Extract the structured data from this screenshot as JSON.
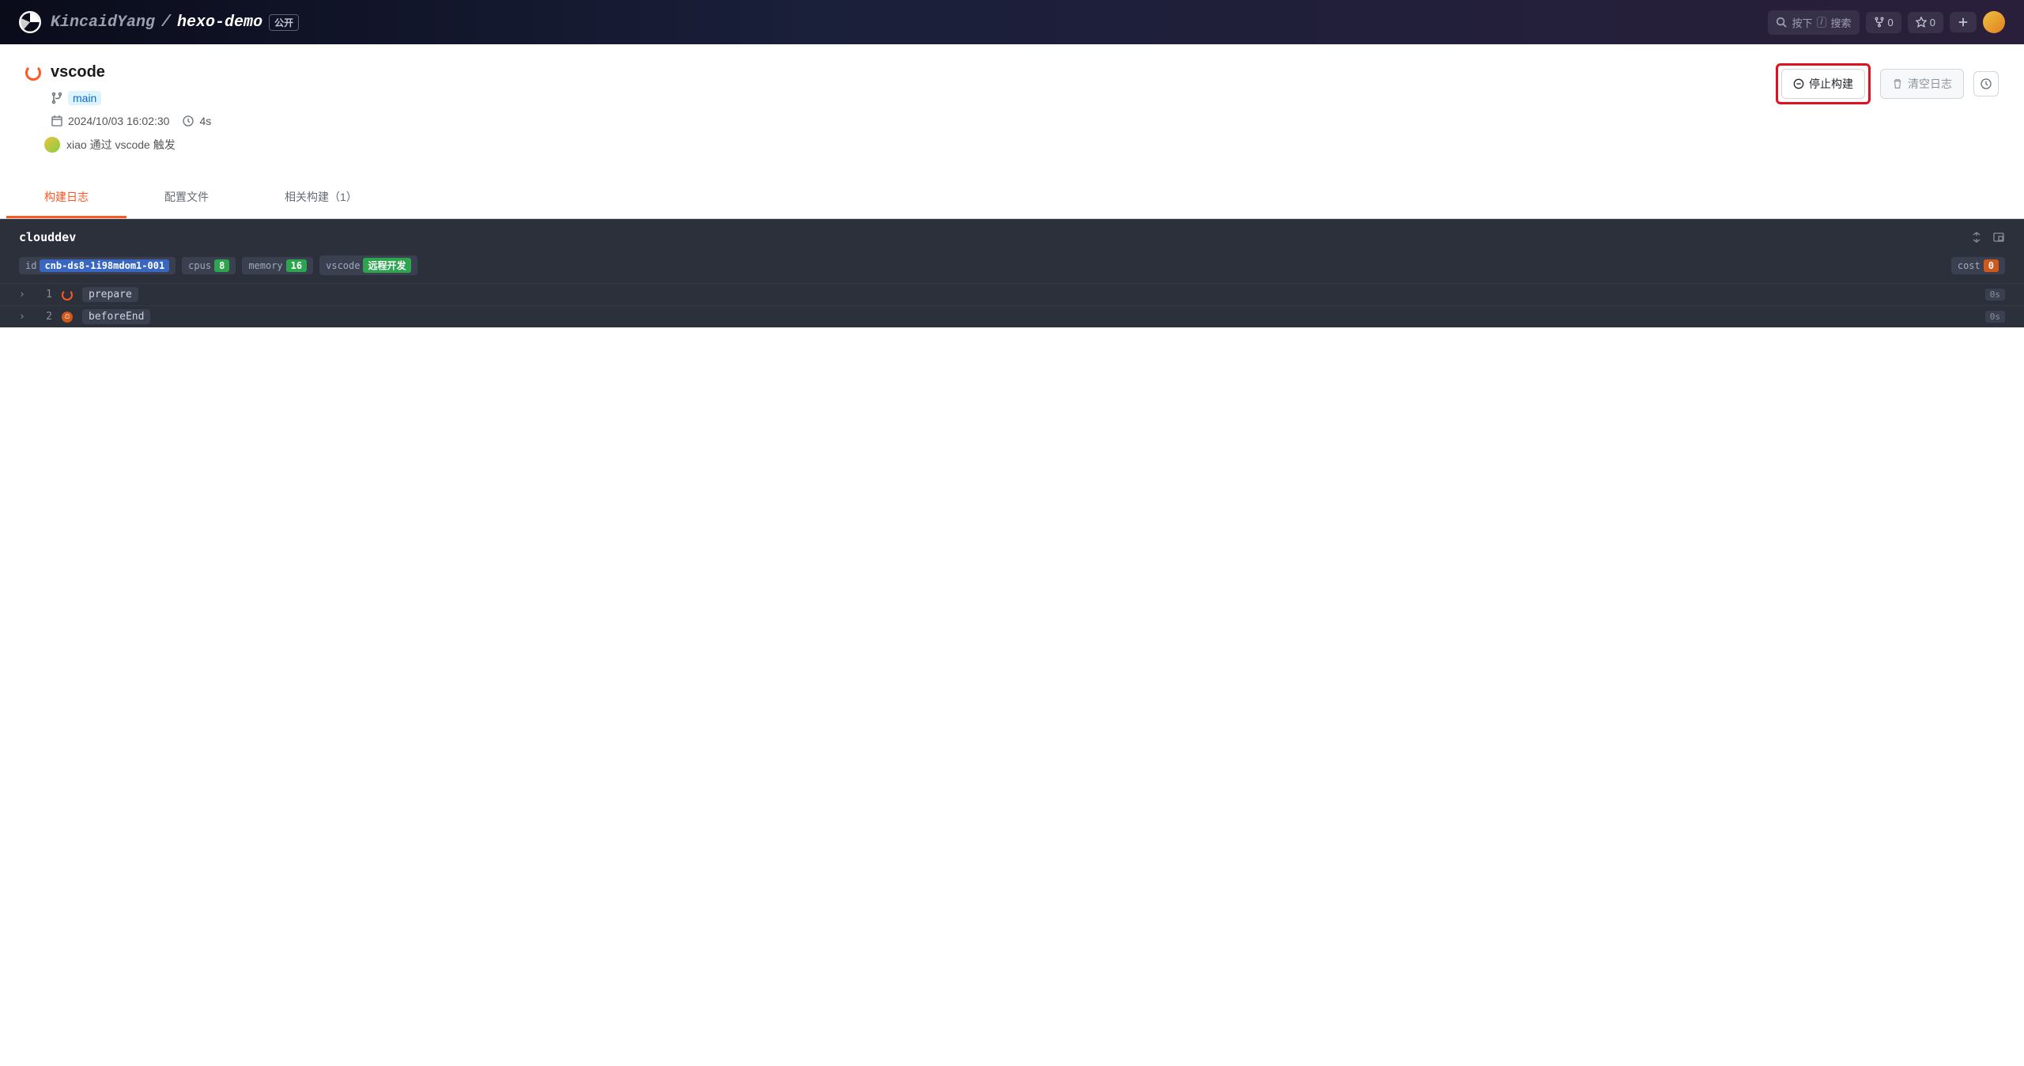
{
  "topbar": {
    "owner": "KincaidYang",
    "repo": "hexo-demo",
    "visibility": "公开",
    "search_prefix": "按下",
    "search_suffix": "搜索",
    "search_key": "/",
    "fork_count": "0",
    "star_count": "0"
  },
  "header": {
    "title": "vscode",
    "branch": "main",
    "datetime": "2024/10/03 16:02:30",
    "duration": "4s",
    "trigger_text": "xiao 通过 vscode 触发"
  },
  "actions": {
    "stop_label": "停止构建",
    "clear_label": "清空日志"
  },
  "tabs": {
    "build_log": "构建日志",
    "config": "配置文件",
    "related": "相关构建（1）"
  },
  "log": {
    "title": "clouddev",
    "tags": {
      "id_label": "id",
      "id_val": "cnb-ds8-1i98mdom1-001",
      "cpus_label": "cpus",
      "cpus_val": "8",
      "memory_label": "memory",
      "memory_val": "16",
      "vscode_label": "vscode",
      "vscode_val": "远程开发",
      "cost_label": "cost",
      "cost_val": "0"
    },
    "steps": [
      {
        "num": "1",
        "name": "prepare",
        "dur": "0s",
        "status": "running"
      },
      {
        "num": "2",
        "name": "beforeEnd",
        "dur": "0s",
        "status": "pending"
      }
    ]
  }
}
